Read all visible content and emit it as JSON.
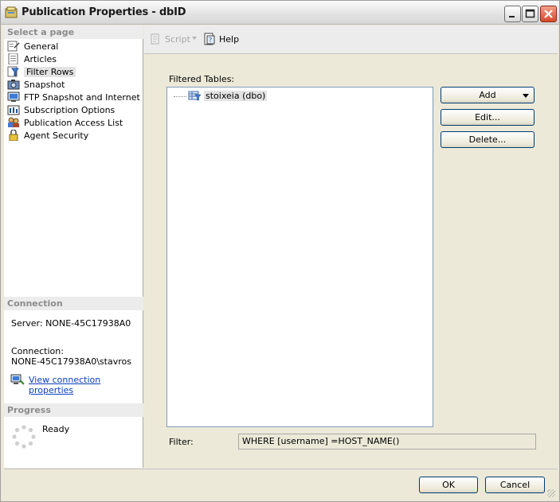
{
  "window": {
    "title": "Publication Properties - dbID"
  },
  "left_pane": {
    "select_page_header": "Select a page",
    "pages": [
      {
        "label": "General",
        "icon": "general-page-icon"
      },
      {
        "label": "Articles",
        "icon": "articles-page-icon"
      },
      {
        "label": "Filter Rows",
        "icon": "filter-rows-page-icon",
        "selected": true
      },
      {
        "label": "Snapshot",
        "icon": "snapshot-page-icon"
      },
      {
        "label": "FTP Snapshot and Internet",
        "icon": "ftp-page-icon"
      },
      {
        "label": "Subscription Options",
        "icon": "subscription-options-page-icon"
      },
      {
        "label": "Publication Access List",
        "icon": "access-list-page-icon"
      },
      {
        "label": "Agent Security",
        "icon": "agent-security-page-icon"
      }
    ],
    "connection_header": "Connection",
    "server_text": "Server: NONE-45C17938A0",
    "connection_label": "Connection:",
    "connection_value": "NONE-45C17938A0\\stavros",
    "view_connection_link": "View connection properties",
    "progress_header": "Progress",
    "progress_status": "Ready"
  },
  "toolbar": {
    "script_label": "Script",
    "help_label": "Help"
  },
  "main": {
    "filtered_tables_label": "Filtered Tables:",
    "tables": [
      {
        "label": "stoixeia (dbo)"
      }
    ],
    "add_label": "Add",
    "edit_label": "Edit...",
    "delete_label": "Delete...",
    "filter_label": "Filter:",
    "filter_value": "WHERE [username] =HOST_NAME()"
  },
  "footer": {
    "ok_label": "OK",
    "cancel_label": "Cancel"
  }
}
